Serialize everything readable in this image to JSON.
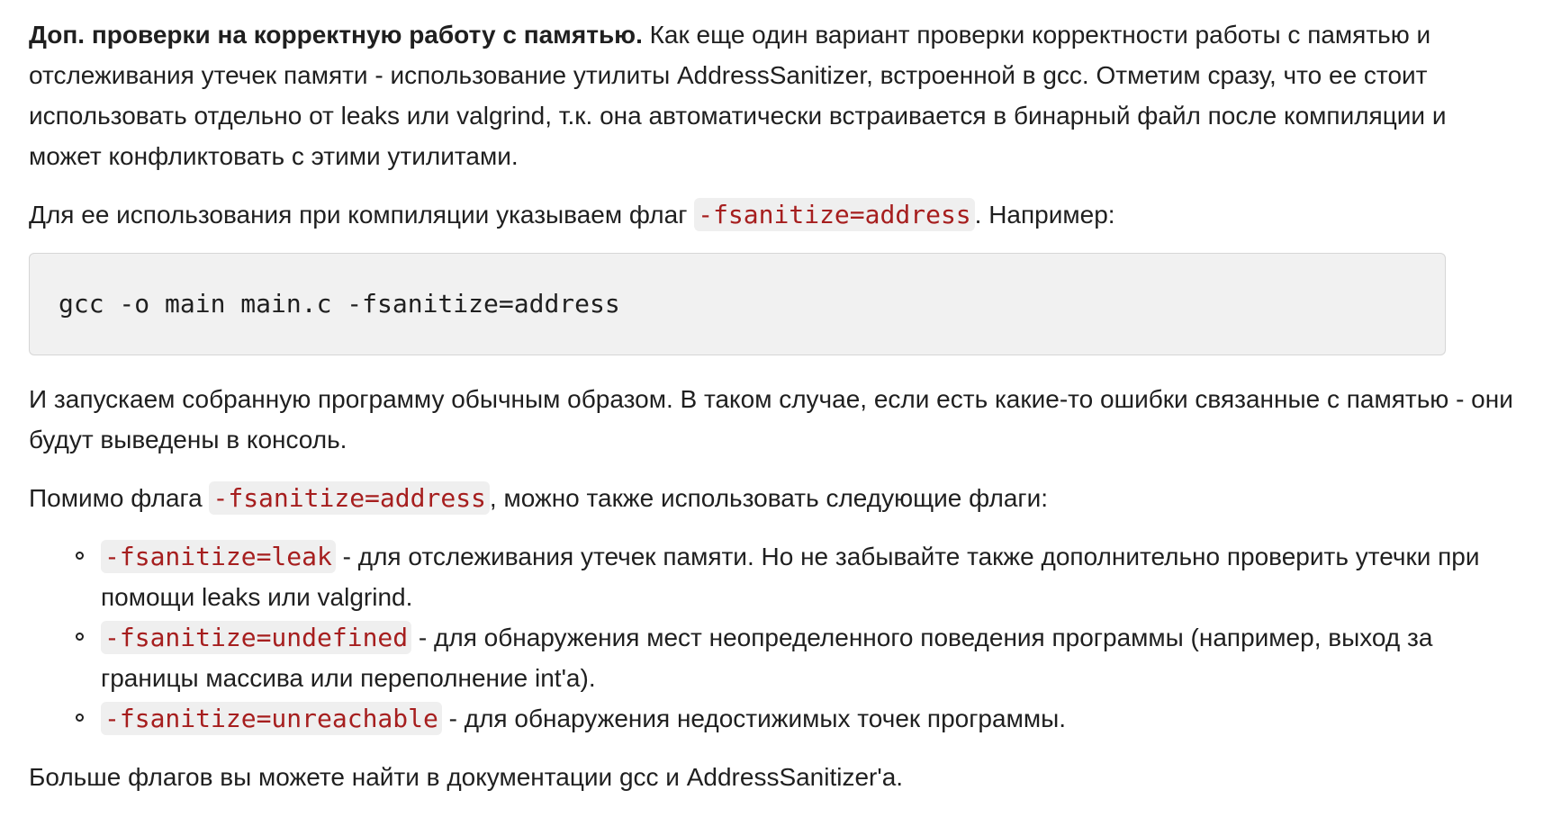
{
  "intro": {
    "bold": "Доп. проверки на корректную работу с памятью.",
    "text": " Как еще один вариант проверки корректности работы с памятью и отслеживания утечек памяти - использование утилиты AddressSanitizer, встроенной в gcc. Отметим сразу, что ее стоит использовать отдельно от leaks или valgrind, т.к. она автоматически встраивается в бинарный файл после компиляции и может конфликтовать с этими утилитами."
  },
  "usage": {
    "before": "Для ее использования при компиляции указываем флаг ",
    "flag": "-fsanitize=address",
    "after": ". Например:"
  },
  "code_block": "gcc -o main main.c -fsanitize=address",
  "run_text": "И запускаем собранную программу обычным образом. В таком случае, если есть какие-то ошибки связанные с памятью - они будут выведены в консоль.",
  "also": {
    "before": "Помимо флага ",
    "flag": "-fsanitize=address",
    "after": ", можно также использовать следующие флаги:"
  },
  "flags": [
    {
      "flag": "-fsanitize=leak",
      "desc": " - для отслеживания утечек памяти. Но не забывайте также дополнительно проверить утечки при помощи leaks или valgrind."
    },
    {
      "flag": "-fsanitize=undefined",
      "desc": " - для обнаружения мест неопределенного поведения программы (например, выход за границы массива или переполнение int'а)."
    },
    {
      "flag": "-fsanitize=unreachable",
      "desc": " - для обнаружения недостижимых точек программы."
    }
  ],
  "outro": "Больше флагов вы можете найти в документации gcc и AddressSanitizer'а."
}
